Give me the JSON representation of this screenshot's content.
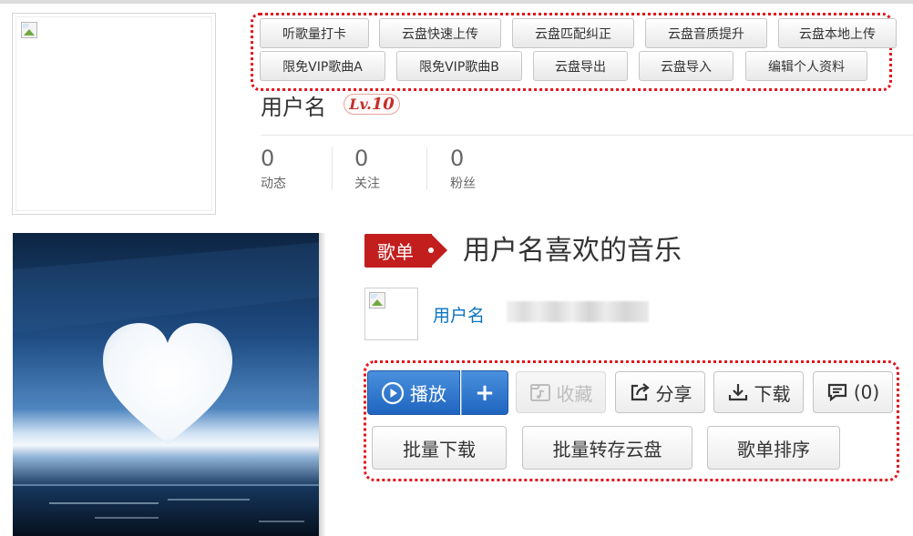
{
  "profile": {
    "username": "用户名",
    "level": {
      "prefix": "Lv.",
      "number": "10"
    },
    "toolbar_row1": [
      "听歌量打卡",
      "云盘快速上传",
      "云盘匹配纠正",
      "云盘音质提升",
      "云盘本地上传"
    ],
    "toolbar_row2": [
      "限免VIP歌曲A",
      "限免VIP歌曲B",
      "云盘导出",
      "云盘导入",
      "编辑个人资料"
    ],
    "stats": [
      {
        "value": "0",
        "label": "动态"
      },
      {
        "value": "0",
        "label": "关注"
      },
      {
        "value": "0",
        "label": "粉丝"
      }
    ]
  },
  "playlist": {
    "tag": "歌单",
    "title": "用户名喜欢的音乐",
    "creator": "用户名",
    "play_label": "播放",
    "add_label": "+",
    "actions": {
      "collect": "收藏",
      "share": "分享",
      "download": "下载",
      "comment": "(0)"
    },
    "batch_actions": [
      "批量下载",
      "批量转存云盘",
      "歌单排序"
    ]
  },
  "colors": {
    "accent_red": "#c21e1e",
    "link_blue": "#0c73c2",
    "play_blue": "#2a6fcc",
    "annotation_red": "#e0161d"
  }
}
